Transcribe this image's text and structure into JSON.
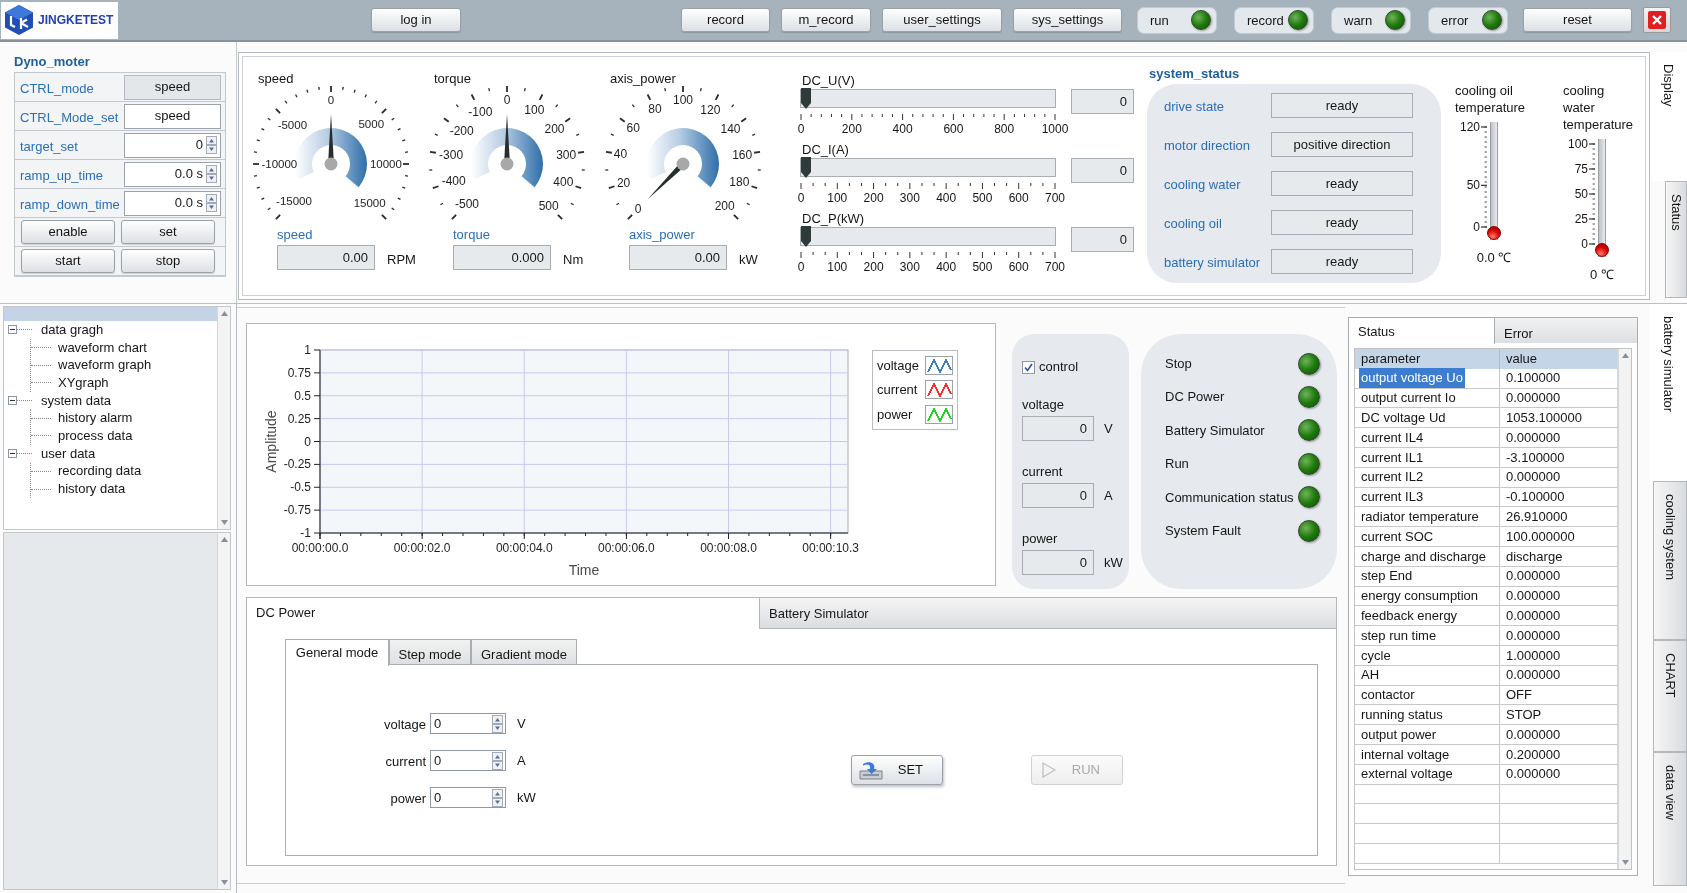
{
  "header": {
    "logo_text": "JINGKETEST",
    "login": "log in",
    "buttons": [
      "record",
      "m_record",
      "user_settings",
      "sys_settings"
    ],
    "lamps": [
      {
        "label": "run",
        "on": false
      },
      {
        "label": "record",
        "on": false
      },
      {
        "label": "warn",
        "on": false
      },
      {
        "label": "error",
        "on": false
      }
    ],
    "reset": "reset"
  },
  "dyno": {
    "title": "Dyno_moter",
    "fields": [
      {
        "label": "CTRL_mode",
        "value": "speed",
        "kind": "indicator"
      },
      {
        "label": "CTRL_Mode_set",
        "value": "speed",
        "kind": "select"
      },
      {
        "label": "target_set",
        "value": "0",
        "kind": "numeric"
      },
      {
        "label": "ramp_up_time",
        "value": "0.0 s",
        "kind": "numeric"
      },
      {
        "label": "ramp_down_time",
        "value": "0.0 s",
        "kind": "numeric"
      }
    ],
    "buttons": [
      "enable",
      "set",
      "start",
      "stop"
    ]
  },
  "gauges": [
    {
      "title": "speed",
      "scale": [
        "0",
        "-5000",
        "5000",
        "-10000",
        "10000",
        "-15000",
        "15000"
      ],
      "label": "speed",
      "reading": "0.00",
      "unit": "RPM"
    },
    {
      "title": "torque",
      "scale": [
        "0",
        "-100",
        "100",
        "-200",
        "200",
        "-300",
        "300",
        "-400",
        "400",
        "-500",
        "500"
      ],
      "label": "torque",
      "reading": "0.000",
      "unit": "Nm"
    },
    {
      "title": "axis_power",
      "scale": [
        "100",
        "80",
        "120",
        "60",
        "140",
        "40",
        "160",
        "20",
        "180",
        "0",
        "200"
      ],
      "label": "axis_power",
      "reading": "0.00",
      "unit": "kW"
    }
  ],
  "bars": [
    {
      "label": "DC_U(V)",
      "level": 0,
      "scale": [
        "0",
        "200",
        "400",
        "600",
        "800",
        "1000"
      ],
      "reading": "0"
    },
    {
      "label": "DC_I(A)",
      "level": 0,
      "scale": [
        "0",
        "100",
        "200",
        "300",
        "400",
        "500",
        "600",
        "700"
      ],
      "reading": "0"
    },
    {
      "label": "DC_P(kW)",
      "level": 0,
      "scale": [
        "0",
        "100",
        "200",
        "300",
        "400",
        "500",
        "600",
        "700"
      ],
      "reading": "0"
    }
  ],
  "system_status": {
    "title": "system_status",
    "rows": [
      {
        "label": "drive state",
        "value": "ready"
      },
      {
        "label": "motor direction",
        "value": "positive direction"
      },
      {
        "label": "cooling water",
        "value": "ready"
      },
      {
        "label": "cooling oil",
        "value": "ready"
      },
      {
        "label": "battery simulator",
        "value": "ready"
      }
    ]
  },
  "thermometers": [
    {
      "label": "cooling oil temperature",
      "scale": [
        "120",
        "50",
        "0"
      ],
      "level": 0,
      "reading": "0.0 ℃"
    },
    {
      "label": "cooling water temperature",
      "scale": [
        "100",
        "75",
        "50",
        "25",
        "0"
      ],
      "level": 0,
      "reading": "0 ℃"
    }
  ],
  "top_tabs": [
    {
      "label": "Display",
      "selected": true
    },
    {
      "label": "Status",
      "selected": false
    }
  ],
  "tree": [
    {
      "label": "data gragh",
      "expanded": true,
      "children": [
        {
          "label": "waveform chart"
        },
        {
          "label": "waveform graph"
        },
        {
          "label": "XYgraph"
        }
      ]
    },
    {
      "label": "system data",
      "expanded": true,
      "children": [
        {
          "label": "history alarm"
        },
        {
          "label": "process data"
        }
      ]
    },
    {
      "label": "user data",
      "expanded": true,
      "children": [
        {
          "label": "recording data"
        },
        {
          "label": "history data"
        }
      ]
    }
  ],
  "chart": {
    "chart_data": {
      "type": "line",
      "xlabel": "Time",
      "ylabel": "Amplitude",
      "categories": [
        "00:00:00.0",
        "00:00:02.0",
        "00:00:04.0",
        "00:00:06.0",
        "00:00:08.0",
        "00:00:10.3"
      ],
      "ylim": [
        -1,
        1
      ],
      "yticks": [
        -1,
        -0.75,
        -0.5,
        -0.25,
        0,
        0.25,
        0.5,
        0.75,
        1
      ],
      "grid": true
    },
    "legend": [
      {
        "name": "voltage",
        "color": "#3d7fc4"
      },
      {
        "name": "current",
        "color": "#ff2a2a"
      },
      {
        "name": "power",
        "color": "#1fd41f"
      }
    ]
  },
  "control": {
    "checkbox": {
      "label": "control",
      "checked": true
    },
    "fields": [
      {
        "label": "voltage",
        "value": "0",
        "unit": "V"
      },
      {
        "label": "current",
        "value": "0",
        "unit": "A"
      },
      {
        "label": "power",
        "value": "0",
        "unit": "kW"
      }
    ]
  },
  "indicators": [
    {
      "label": "Stop",
      "on": false
    },
    {
      "label": "DC Power",
      "on": false
    },
    {
      "label": "Battery Simulator",
      "on": false
    },
    {
      "label": "Run",
      "on": false
    },
    {
      "label": "Communication status",
      "on": false
    },
    {
      "label": "System Fault",
      "on": false
    }
  ],
  "power_tabs": [
    {
      "label": "DC Power",
      "selected": true
    },
    {
      "label": "Battery Simulator",
      "selected": false
    }
  ],
  "mode_tabs": [
    {
      "label": "General mode",
      "selected": true
    },
    {
      "label": "Step mode",
      "selected": false
    },
    {
      "label": "Gradient mode",
      "selected": false
    }
  ],
  "mode_fields": [
    {
      "label": "voltage",
      "value": "0",
      "unit": "V"
    },
    {
      "label": "current",
      "value": "0",
      "unit": "A"
    },
    {
      "label": "power",
      "value": "0",
      "unit": "kW"
    }
  ],
  "set_button": "SET",
  "run_button": {
    "label": "RUN",
    "disabled": true
  },
  "table_tabs": [
    {
      "label": "Status",
      "selected": true
    },
    {
      "label": "Error",
      "selected": false
    }
  ],
  "table": {
    "columns": [
      "parameter",
      "value"
    ],
    "rows": [
      {
        "cells": [
          "output voltage Uo",
          "0.100000"
        ],
        "selected": true
      },
      {
        "cells": [
          "output current Io",
          "0.000000"
        ],
        "selected": false
      },
      {
        "cells": [
          "DC voltage Ud",
          "1053.100000"
        ],
        "selected": false
      },
      {
        "cells": [
          "current IL4",
          "0.000000"
        ],
        "selected": false
      },
      {
        "cells": [
          "current IL1",
          "-3.100000"
        ],
        "selected": false
      },
      {
        "cells": [
          "current IL2",
          "0.000000"
        ],
        "selected": false
      },
      {
        "cells": [
          "current IL3",
          "-0.100000"
        ],
        "selected": false
      },
      {
        "cells": [
          "radiator temperature",
          "26.910000"
        ],
        "selected": false
      },
      {
        "cells": [
          "current SOC",
          "100.000000"
        ],
        "selected": false
      },
      {
        "cells": [
          "charge and discharge",
          "discharge"
        ],
        "selected": false
      },
      {
        "cells": [
          "step End",
          "0.000000"
        ],
        "selected": false
      },
      {
        "cells": [
          "energy consumption",
          "0.000000"
        ],
        "selected": false
      },
      {
        "cells": [
          "feedback energy",
          "0.000000"
        ],
        "selected": false
      },
      {
        "cells": [
          "step run time",
          "0.000000"
        ],
        "selected": false
      },
      {
        "cells": [
          "cycle",
          "1.000000"
        ],
        "selected": false
      },
      {
        "cells": [
          "AH",
          "0.000000"
        ],
        "selected": false
      },
      {
        "cells": [
          "contactor",
          "OFF"
        ],
        "selected": false
      },
      {
        "cells": [
          "running status",
          "STOP"
        ],
        "selected": false
      },
      {
        "cells": [
          "output power",
          "0.000000"
        ],
        "selected": false
      },
      {
        "cells": [
          "internal voltage",
          "0.200000"
        ],
        "selected": false
      },
      {
        "cells": [
          "external voltage",
          "0.000000"
        ],
        "selected": false
      }
    ]
  },
  "side_tabs": [
    {
      "label": "battery simulator",
      "selected": true
    },
    {
      "label": "cooling system",
      "selected": false
    },
    {
      "label": "CHART",
      "selected": false
    },
    {
      "label": "data view",
      "selected": false
    }
  ]
}
